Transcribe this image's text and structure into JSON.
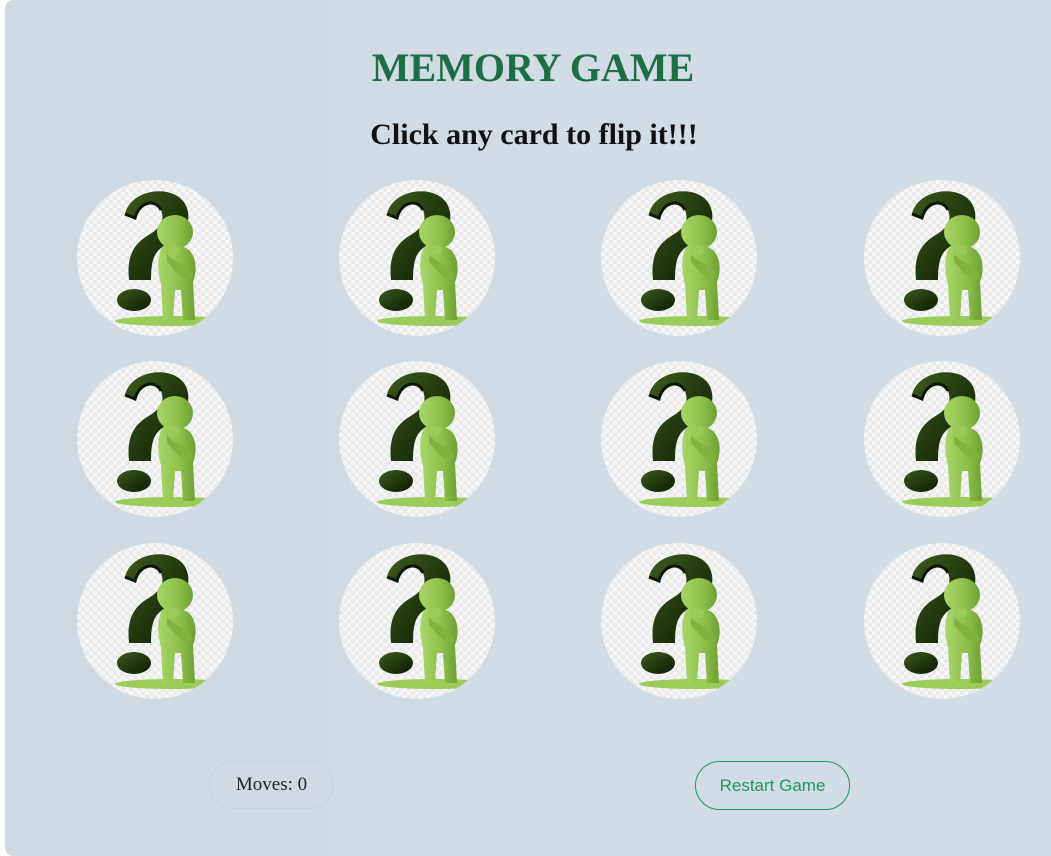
{
  "game": {
    "title": "MEMORY GAME",
    "instruction": "Click any card to flip it!!!"
  },
  "board": {
    "rows": 3,
    "columns": 4,
    "card_back_icon": "question-mark-thinker-icon",
    "cards": [
      {
        "face": "down"
      },
      {
        "face": "down"
      },
      {
        "face": "down"
      },
      {
        "face": "down"
      },
      {
        "face": "down"
      },
      {
        "face": "down"
      },
      {
        "face": "down"
      },
      {
        "face": "down"
      },
      {
        "face": "down"
      },
      {
        "face": "down"
      },
      {
        "face": "down"
      },
      {
        "face": "down"
      }
    ]
  },
  "footer": {
    "moves_text": "Moves: 0",
    "restart_label": "Restart Game"
  },
  "colors": {
    "title": "#1d6d47",
    "accent": "#1e9a5c",
    "background": "#d0dbe4"
  }
}
